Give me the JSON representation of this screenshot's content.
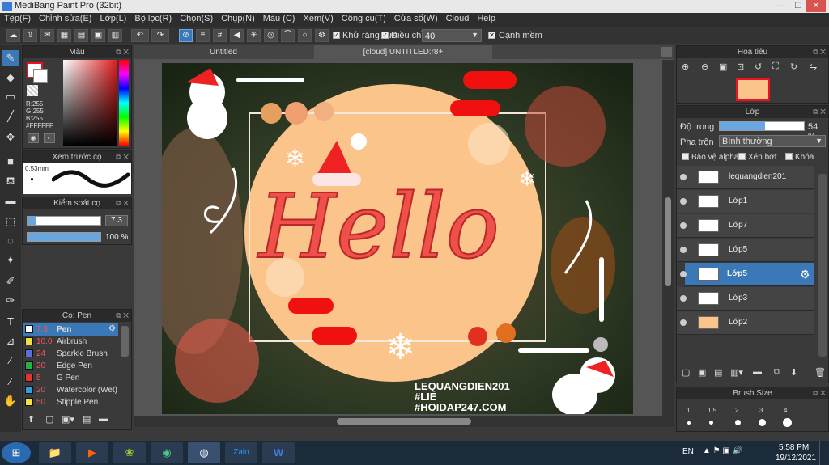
{
  "app": {
    "title": "MediBang Paint Pro (32bit)"
  },
  "menu": [
    "Tệp(F)",
    "Chỉnh sửa(E)",
    "Lớp(L)",
    "Bộ lọc(R)",
    "Chọn(S)",
    "Chụp(N)",
    "Màu (C)",
    "Xem(V)",
    "Công cụ(T)",
    "Cửa sổ(W)",
    "Cloud",
    "Help"
  ],
  "toolbar": {
    "antialias_label": "Khử răng cưa",
    "adjust_label": "Điều chỉnh",
    "adjust_value": "40",
    "sharp_edge_label": "Cạnh mềm"
  },
  "color_panel": {
    "title": "Màu",
    "r": "R:255",
    "g": "G:255",
    "b": "B:255",
    "hex": "#FFFFFF"
  },
  "brush_preview": {
    "title": "Xem trước cọ",
    "size": "0.53mm"
  },
  "brush_control": {
    "title": "Kiểm soát cọ",
    "size_value": "7.3",
    "opacity_value": "100 %"
  },
  "brush_list": {
    "title": "Cọ: Pen",
    "items": [
      {
        "size": "7.3",
        "name": "Pen",
        "color": "#ffffff"
      },
      {
        "size": "10.0",
        "name": "Airbrush",
        "color": "#f0e040"
      },
      {
        "size": "24",
        "name": "Sparkle Brush",
        "color": "#5c6de0"
      },
      {
        "size": "20",
        "name": "Edge Pen",
        "color": "#1db34a"
      },
      {
        "size": "5",
        "name": "G Pen",
        "color": "#e23232"
      },
      {
        "size": "20",
        "name": "Watercolor (Wet)",
        "color": "#30a0e0"
      },
      {
        "size": "50",
        "name": "Stipple Pen",
        "color": "#f2e43a"
      }
    ]
  },
  "tabs": {
    "tab1": "Untitled",
    "tab2": "[cloud] UNTITLED:r8+"
  },
  "artwork": {
    "title": "Hello",
    "watermark_line1": "LEQUANGDIEN201",
    "watermark_line2": "#LIE",
    "watermark_line3": "#HOIDAP247.COM"
  },
  "navigator": {
    "title": "Hoa tiêu"
  },
  "layers": {
    "title": "Lớp",
    "opacity_label": "Độ trong",
    "opacity_value": "54 %",
    "opacity": 0.54,
    "blend_label": "Pha trộn",
    "blend_value": "Bình thường",
    "protect_alpha": "Bảo vệ alpha",
    "clip": "Xén bớt",
    "lock": "Khóa",
    "items": [
      "lequangdien201",
      "Lớp1",
      "Lớp7",
      "Lớp5",
      "Lớp5",
      "Lớp3",
      "Lớp2"
    ]
  },
  "brush_size": {
    "title": "Brush Size",
    "values": [
      "1",
      "1.5",
      "2",
      "3",
      "4"
    ]
  },
  "taskbar": {
    "lang": "EN",
    "time": "5:58 PM",
    "date": "19/12/2021"
  }
}
